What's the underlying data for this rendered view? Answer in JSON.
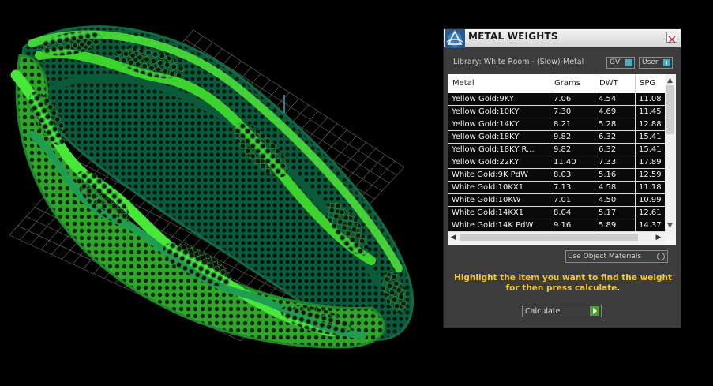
{
  "panel": {
    "title": "METAL WEIGHTS",
    "library_label": "Library: White Room - (Slow)-Metal",
    "gv_toggle_label": "GV",
    "user_toggle_label": "User",
    "columns": [
      "Metal",
      "Grams",
      "DWT",
      "SPG"
    ],
    "rows": [
      {
        "metal": "Yellow Gold:9KY",
        "grams": "7.06",
        "dwt": "4.54",
        "spg": "11.08"
      },
      {
        "metal": "Yellow Gold:10KY",
        "grams": "7.30",
        "dwt": "4.69",
        "spg": "11.45"
      },
      {
        "metal": "Yellow Gold:14KY",
        "grams": "8.21",
        "dwt": "5.28",
        "spg": "12.88"
      },
      {
        "metal": "Yellow Gold:18KY",
        "grams": "9.82",
        "dwt": "6.32",
        "spg": "15.41"
      },
      {
        "metal": "Yellow Gold:18KY R...",
        "grams": "9.82",
        "dwt": "6.32",
        "spg": "15.41"
      },
      {
        "metal": "Yellow Gold:22KY",
        "grams": "11.40",
        "dwt": "7.33",
        "spg": "17.89"
      },
      {
        "metal": "White Gold:9K PdW",
        "grams": "8.03",
        "dwt": "5.16",
        "spg": "12.59"
      },
      {
        "metal": "White Gold:10KX1",
        "grams": "7.13",
        "dwt": "4.58",
        "spg": "11.18"
      },
      {
        "metal": "White Gold:10KW",
        "grams": "7.01",
        "dwt": "4.50",
        "spg": "10.99"
      },
      {
        "metal": "White Gold:14KX1",
        "grams": "8.04",
        "dwt": "5.17",
        "spg": "12.61"
      },
      {
        "metal": "White Gold:14K PdW",
        "grams": "9.16",
        "dwt": "5.89",
        "spg": "14.37"
      }
    ],
    "use_object_materials_label": "Use Object Materials",
    "hint_line1": "Highlight the item you want to find the weight",
    "hint_line2": "for then press calculate.",
    "calculate_label": "Calculate"
  },
  "colors": {
    "ring_bright": "#3cd42c",
    "ring_dark": "#0f6b46",
    "panel_bg": "#3c3c3c",
    "hint_yellow": "#f3c82a",
    "axis_red": "#c02020",
    "axis_cyan": "#38b6c8",
    "selected_row_bg": "#0a0a0a"
  },
  "icons": {
    "app_logo": "triangle-logo-icon",
    "close": "close-icon",
    "toggle_knob": "toggle-knob-icon",
    "scroll_up": "scroll-up-icon",
    "scroll_down": "scroll-down-icon",
    "scroll_left": "scroll-left-icon",
    "scroll_right": "scroll-right-icon",
    "play": "play-icon",
    "radio": "radio-icon"
  }
}
